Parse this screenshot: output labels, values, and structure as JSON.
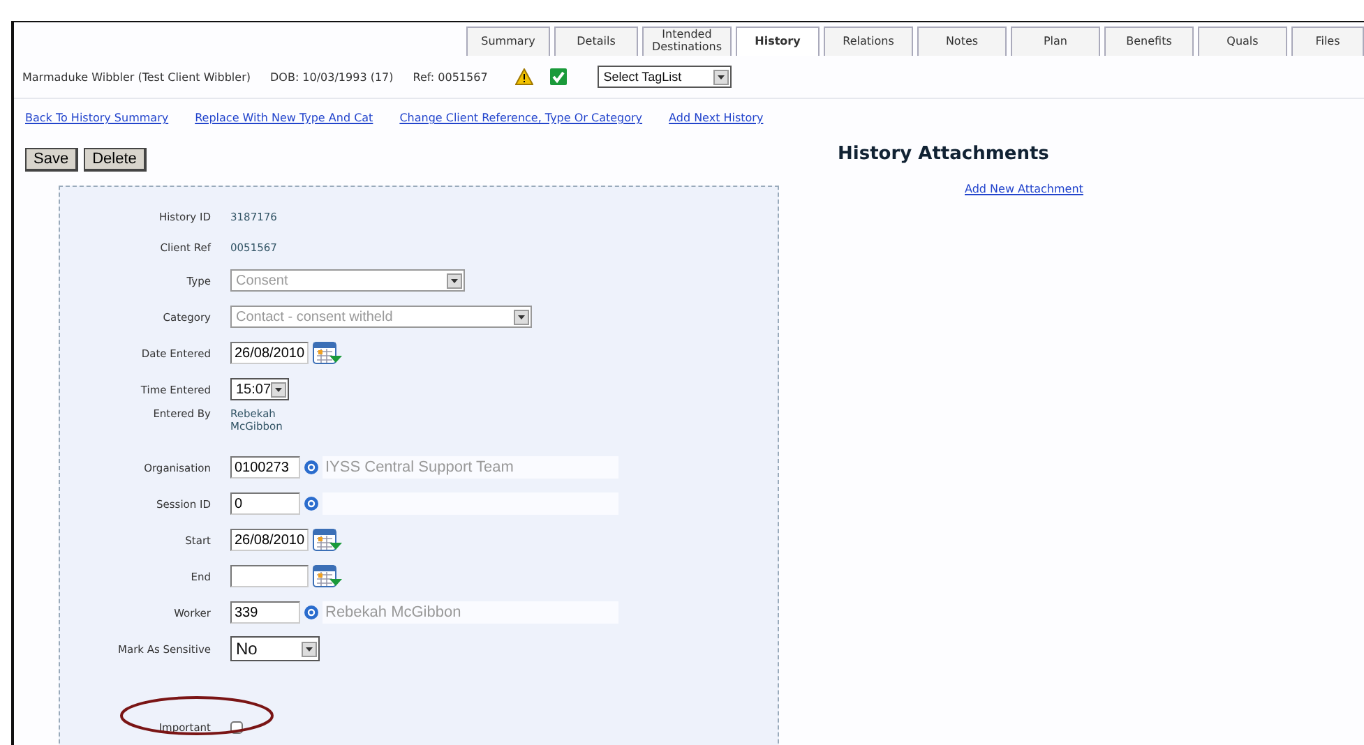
{
  "tabs": [
    {
      "label": "Summary",
      "selected": false
    },
    {
      "label": "Details",
      "selected": false
    },
    {
      "label": "Intended Destinations",
      "selected": false
    },
    {
      "label": "History",
      "selected": true
    },
    {
      "label": "Relations",
      "selected": false
    },
    {
      "label": "Notes",
      "selected": false
    },
    {
      "label": "Plan",
      "selected": false
    },
    {
      "label": "Benefits",
      "selected": false
    },
    {
      "label": "Quals",
      "selected": false
    },
    {
      "label": "Files",
      "selected": false
    }
  ],
  "client": {
    "name": "Marmaduke Wibbler (Test Client Wibbler)",
    "dob": "DOB: 10/03/1993 (17)",
    "ref": "Ref: 0051567",
    "taglist": "Select TagList"
  },
  "links": [
    "Back To History Summary",
    "Replace With New Type And Cat",
    "Change Client Reference, Type Or Category",
    "Add Next History"
  ],
  "buttons": [
    "Save",
    "Delete"
  ],
  "fields": [
    {
      "kind": "text",
      "label": "History ID",
      "value": "3187176"
    },
    {
      "kind": "text",
      "label": "Client Ref",
      "value": "0051567"
    },
    {
      "kind": "select",
      "label": "Type",
      "value": "Consent",
      "disabled": true
    },
    {
      "kind": "select",
      "label": "Category",
      "value": "Contact - consent witheld",
      "disabled": true
    },
    {
      "kind": "date",
      "label": "Date Entered",
      "value": "26/08/2010"
    },
    {
      "kind": "select",
      "label": "Time Entered",
      "value": "15:07",
      "disabled": false
    },
    {
      "kind": "text",
      "label": "Entered By",
      "value": "Rebekah McGibbon"
    },
    {
      "kind": "lookup",
      "label": "Organisation",
      "value": "0100273",
      "description": "IYSS Central Support Team"
    },
    {
      "kind": "lookup",
      "label": "Session ID",
      "value": "0"
    },
    {
      "kind": "date",
      "label": "Start",
      "value": "26/08/2010"
    },
    {
      "kind": "date",
      "label": "End"
    },
    {
      "kind": "lookup",
      "label": "Worker",
      "value": "339",
      "description": "Rebekah McGibbon"
    },
    {
      "kind": "select",
      "label": "Mark As Sensitive",
      "value": "No",
      "disabled": false
    },
    {
      "kind": "checkbox",
      "label": "Important",
      "checked": false,
      "highlighted": true
    }
  ],
  "attachments": {
    "title": "History Attachments",
    "link": "Add New Attachment"
  }
}
